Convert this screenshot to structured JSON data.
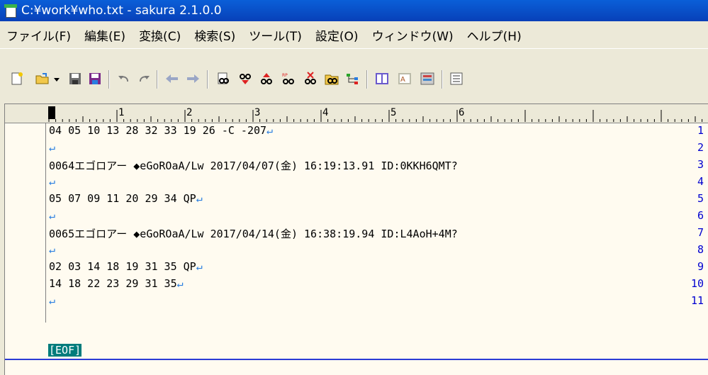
{
  "window": {
    "title": "C:¥work¥who.txt - sakura 2.1.0.0"
  },
  "menu": [
    "ファイル(F)",
    "編集(E)",
    "変換(C)",
    "検索(S)",
    "ツール(T)",
    "設定(O)",
    "ウィンドウ(W)",
    "ヘルプ(H)"
  ],
  "ruler": {
    "marks": [
      "1",
      "2",
      "3",
      "4",
      "5",
      "6"
    ]
  },
  "lines": [
    {
      "num": "1",
      "text": "04 05 10 13 28 32 33 19 26 -C -207",
      "nl": "↵"
    },
    {
      "num": "2",
      "text": "",
      "nl": "↵"
    },
    {
      "num": "3",
      "text": "0064エゴロアー ◆eGoROaA/Lw 2017/04/07(金) 16:19:13.91 ID:0KKH6QMT?",
      "nl": ""
    },
    {
      "num": "4",
      "text": "",
      "nl": "↵"
    },
    {
      "num": "5",
      "text": "05 07 09 11 20 29 34 QP",
      "nl": "↵"
    },
    {
      "num": "6",
      "text": "",
      "nl": "↵"
    },
    {
      "num": "7",
      "text": "0065エゴロアー ◆eGoROaA/Lw 2017/04/14(金) 16:38:19.94 ID:L4AoH+4M?",
      "nl": ""
    },
    {
      "num": "8",
      "text": "",
      "nl": "↵"
    },
    {
      "num": "9",
      "text": "02 03 14 18 19 31 35 QP",
      "nl": "↵"
    },
    {
      "num": "10",
      "text": "14 18 22 23 29 31 35",
      "nl": "↵"
    },
    {
      "num": "11",
      "text": "",
      "nl": "↵"
    }
  ],
  "eof": "[EOF]"
}
